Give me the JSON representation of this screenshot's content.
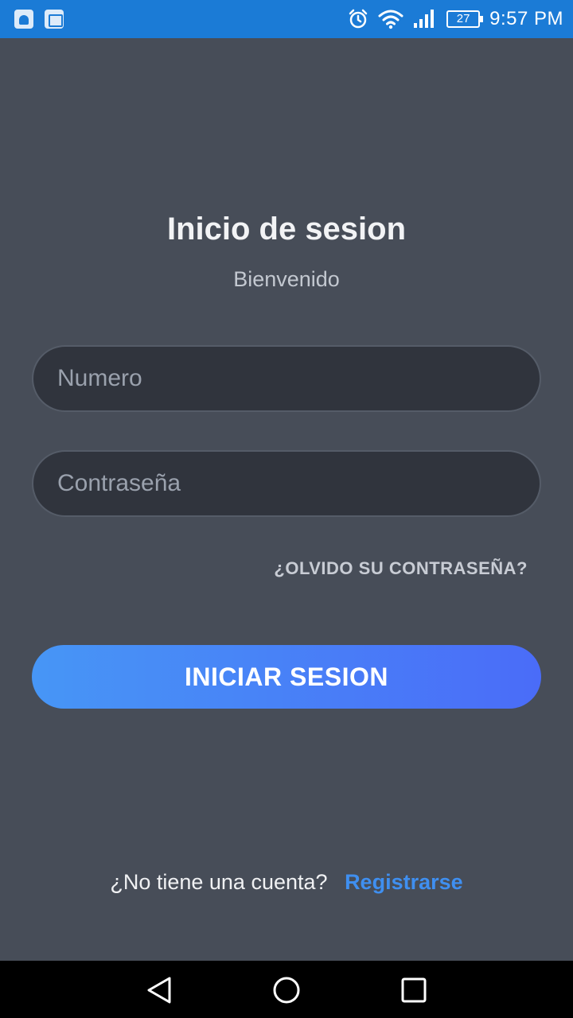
{
  "status_bar": {
    "time": "9:57 PM",
    "battery": "27",
    "icons": [
      "notification-icon",
      "gallery-icon",
      "alarm-icon",
      "wifi-icon",
      "signal-icon",
      "battery-icon"
    ]
  },
  "login": {
    "title": "Inicio de sesion",
    "subtitle": "Bienvenido",
    "number_placeholder": "Numero",
    "password_placeholder": "Contraseña",
    "forgot_label": "¿OLVIDO SU CONTRASEÑA?",
    "login_button": "INICIAR SESION",
    "signup_prompt": "¿No tiene una cuenta?",
    "signup_link": "Registrarse"
  },
  "nav_bar": {
    "icons": [
      "back-icon",
      "home-icon",
      "recents-icon"
    ]
  },
  "colors": {
    "background": "#474d58",
    "status_bar": "#1b7bd6",
    "input_bg": "#30343d",
    "button_gradient_start": "#4796f6",
    "button_gradient_end": "#4a6cf8",
    "link": "#3f8ff0"
  }
}
